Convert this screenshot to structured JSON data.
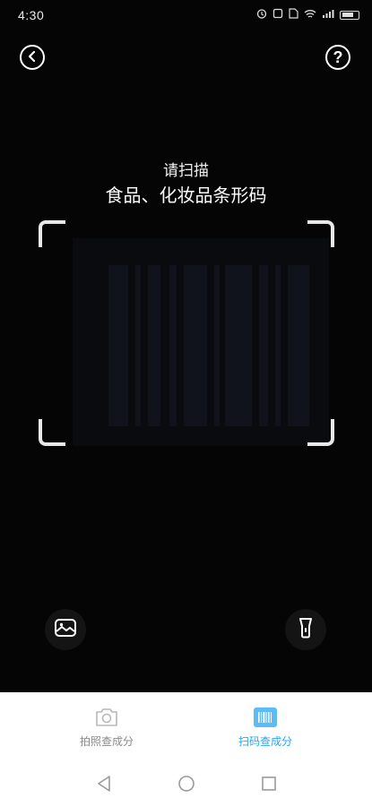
{
  "status_bar": {
    "time": "4:30",
    "icons": [
      "alarm-icon",
      "notification-icon",
      "sim-icon",
      "wifi-icon",
      "signal-icon",
      "battery-icon"
    ]
  },
  "top_bar": {
    "back_icon": "chevron-left-icon",
    "help_icon": "question-icon",
    "help_symbol": "?"
  },
  "hint": {
    "line1": "请扫描",
    "line2": "食品、化妆品条形码"
  },
  "tools": {
    "album_icon": "image-icon",
    "torch_icon": "flashlight-icon"
  },
  "tabs": [
    {
      "label": "拍照查成分",
      "icon": "camera-icon",
      "active": false
    },
    {
      "label": "扫码查成分",
      "icon": "barcode-icon",
      "active": true
    }
  ],
  "colors": {
    "background": "#050505",
    "accent": "#2aa4f4",
    "inactive_tab": "#8a8a8a",
    "panel": "#ffffff"
  }
}
